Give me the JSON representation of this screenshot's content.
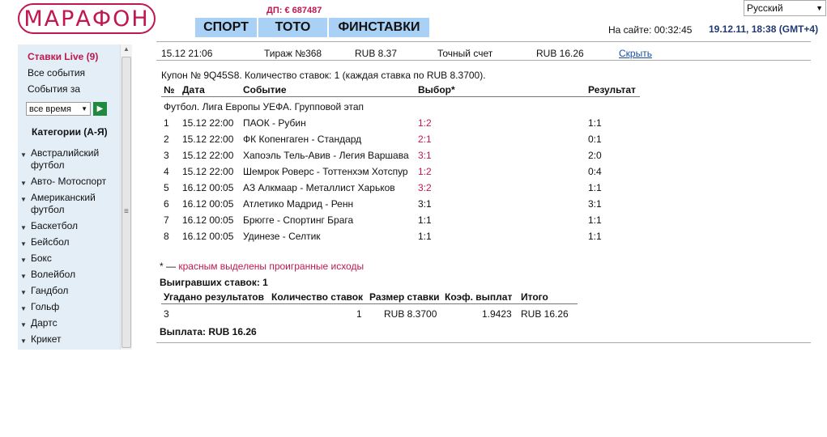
{
  "header": {
    "logo": "МАРАФОН",
    "jackpot": "ДП: € 687487",
    "nav": [
      "СПОРТ",
      "ТОТО",
      "ФИНСТАВКИ"
    ],
    "language": "Русский",
    "online": "На сайте: 00:32:45",
    "datetime": "19.12.11, 18:38 (GMT+4)"
  },
  "sidebar": {
    "live": "Ставки Live (9)",
    "all_events": "Все события",
    "events_for": "События за",
    "period": "все время",
    "categories_title": "Категории (А-Я)",
    "categories": [
      "Австралийский футбол",
      "Авто- Мотоспорт",
      "Американский футбол",
      "Баскетбол",
      "Бейсбол",
      "Бокс",
      "Волейбол",
      "Гандбол",
      "Гольф",
      "Дартс",
      "Крикет"
    ]
  },
  "coupon_row": {
    "date": "15.12 21:06",
    "draw": "Тираж №368",
    "stake": "RUB 8.37",
    "type": "Точный счет",
    "payout": "RUB 16.26",
    "hide": "Скрыть"
  },
  "coupon": {
    "title": "Купон № 9Q45S8. Количество ставок: 1 (каждая ставка по RUB 8.3700).",
    "columns": [
      "№",
      "Дата",
      "Событие",
      "Выбор*",
      "Результат"
    ],
    "league": "Футбол. Лига Европы УЕФА. Групповой этап",
    "rows": [
      {
        "n": "1",
        "date": "15.12 22:00",
        "event": "ПАОК - Рубин",
        "pick": "1:2",
        "result": "1:1",
        "lost": true
      },
      {
        "n": "2",
        "date": "15.12 22:00",
        "event": "ФК Копенгаген - Стандард",
        "pick": "2:1",
        "result": "0:1",
        "lost": true
      },
      {
        "n": "3",
        "date": "15.12 22:00",
        "event": "Хапоэль Тель-Авив - Легия Варшава",
        "pick": "3:1",
        "result": "2:0",
        "lost": true
      },
      {
        "n": "4",
        "date": "15.12 22:00",
        "event": "Шемрок Роверс - Тоттенхэм Хотспур",
        "pick": "1:2",
        "result": "0:4",
        "lost": true
      },
      {
        "n": "5",
        "date": "16.12 00:05",
        "event": "АЗ Алкмаар - Металлист Харьков",
        "pick": "3:2",
        "result": "1:1",
        "lost": true
      },
      {
        "n": "6",
        "date": "16.12 00:05",
        "event": "Атлетико Мадрид - Ренн",
        "pick": "3:1",
        "result": "3:1",
        "lost": false
      },
      {
        "n": "7",
        "date": "16.12 00:05",
        "event": "Брюгге - Спортинг Брага",
        "pick": "1:1",
        "result": "1:1",
        "lost": false
      },
      {
        "n": "8",
        "date": "16.12 00:05",
        "event": "Удинезе - Селтик",
        "pick": "1:1",
        "result": "1:1",
        "lost": false
      }
    ],
    "note_star": "* —",
    "note_text": "красным выделены проигранные исходы",
    "winning_bets": "Выигравших ставок: 1",
    "summary_columns": [
      "Угадано результатов",
      "Количество ставок",
      "Размер ставки",
      "Коэф. выплат",
      "Итого"
    ],
    "summary_row": [
      "3",
      "1",
      "RUB 8.3700",
      "1.9423",
      "RUB 16.26"
    ],
    "payout": "Выплата: RUB 16.26"
  },
  "colors": {
    "brand": "#c0184e",
    "nav_bg": "#a9d0f5",
    "sidebar_bg": "#e4eef7",
    "link": "#1a4fa0",
    "go_button": "#1f8a3e"
  }
}
